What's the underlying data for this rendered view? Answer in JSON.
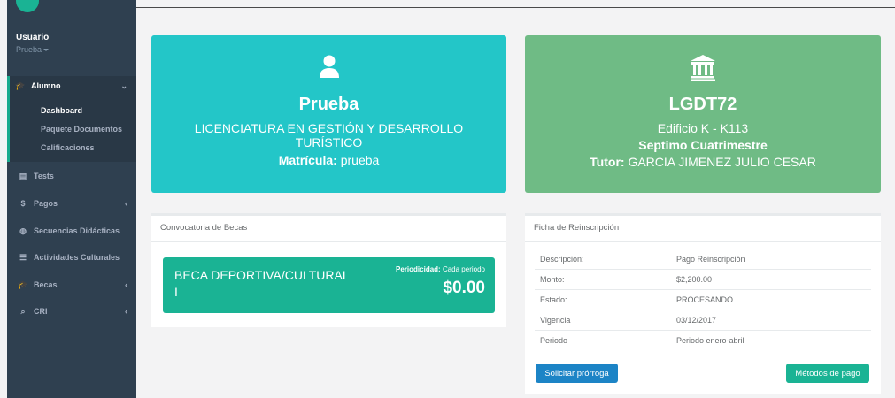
{
  "profile": {
    "name": "Usuario",
    "role": "Prueba"
  },
  "sidebar": {
    "alumno": "Alumno",
    "sub": [
      "Dashboard",
      "Paquete Documentos",
      "Calificaciones"
    ],
    "items": [
      {
        "label": "Tests",
        "icon": "tests-icon"
      },
      {
        "label": "Pagos",
        "icon": "dollar-icon"
      },
      {
        "label": "Secuencias Didácticas",
        "icon": "globe-icon"
      },
      {
        "label": "Actividades Culturales",
        "icon": "list-icon"
      },
      {
        "label": "Becas",
        "icon": "graduation-cap-icon"
      },
      {
        "label": "CRI",
        "icon": "comments-icon"
      }
    ]
  },
  "student": {
    "name": "Prueba",
    "career_line1": "LICENCIATURA EN GESTIÓN Y DESARROLLO",
    "career_line2": "TURÍSTICO",
    "matricula_label": "Matrícula:",
    "matricula": "prueba"
  },
  "group": {
    "code": "LGDT72",
    "location": "Edificio K - K113",
    "term": "Septimo Cuatrimestre",
    "tutor_label": "Tutor:",
    "tutor": "GARCIA JIMENEZ JULIO CESAR"
  },
  "becas": {
    "title": "Convocatoria de Becas",
    "name": "BECA DEPORTIVA/CULTURAL I",
    "period_label": "Periodicidad:",
    "period": "Cada periodo",
    "amount": "$0.00"
  },
  "ficha": {
    "title": "Ficha de Reinscripción",
    "rows": [
      {
        "k": "Descripción:",
        "v": "Pago Reinscripción"
      },
      {
        "k": "Monto:",
        "v": "$2,200.00"
      },
      {
        "k": "Estado:",
        "v": "PROCESANDO"
      },
      {
        "k": "Vigencia",
        "v": "03/12/2017"
      },
      {
        "k": "Periodo",
        "v": "Periodo enero-abril"
      }
    ],
    "btn_extension": "Solicitar prórroga",
    "btn_payment": "Métodos de pago"
  },
  "colors": {
    "sidebar": "#2f4050",
    "cyan": "#23c6c8",
    "green": "#6fbb85",
    "primary": "#1ab394",
    "blue": "#1c84c6"
  }
}
